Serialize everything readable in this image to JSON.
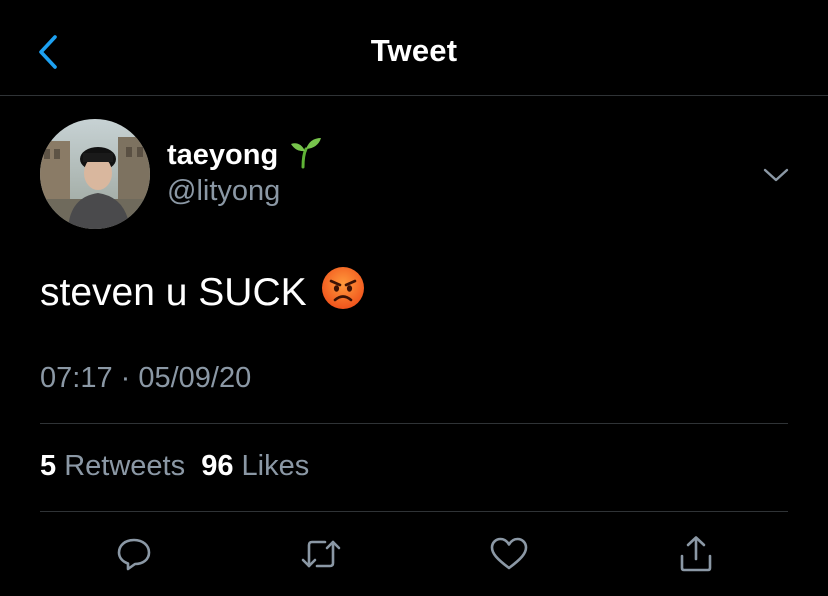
{
  "header": {
    "title": "Tweet",
    "back_icon": "chevron-left-icon"
  },
  "author": {
    "display_name": "taeyong",
    "name_emoji": "seedling-icon",
    "handle": "@lityong"
  },
  "tweet": {
    "text": "steven u SUCK",
    "emoji": "angry-face-icon",
    "timestamp": "07:17 · 05/09/20"
  },
  "stats": {
    "retweets_count": "5",
    "retweets_label": "Retweets",
    "likes_count": "96",
    "likes_label": "Likes"
  },
  "actions": [
    "reply-icon",
    "retweet-icon",
    "like-icon",
    "share-icon"
  ],
  "colors": {
    "background": "#000000",
    "accent": "#1da1f2",
    "secondary_text": "#8b98a5",
    "divider": "#2f3336"
  }
}
